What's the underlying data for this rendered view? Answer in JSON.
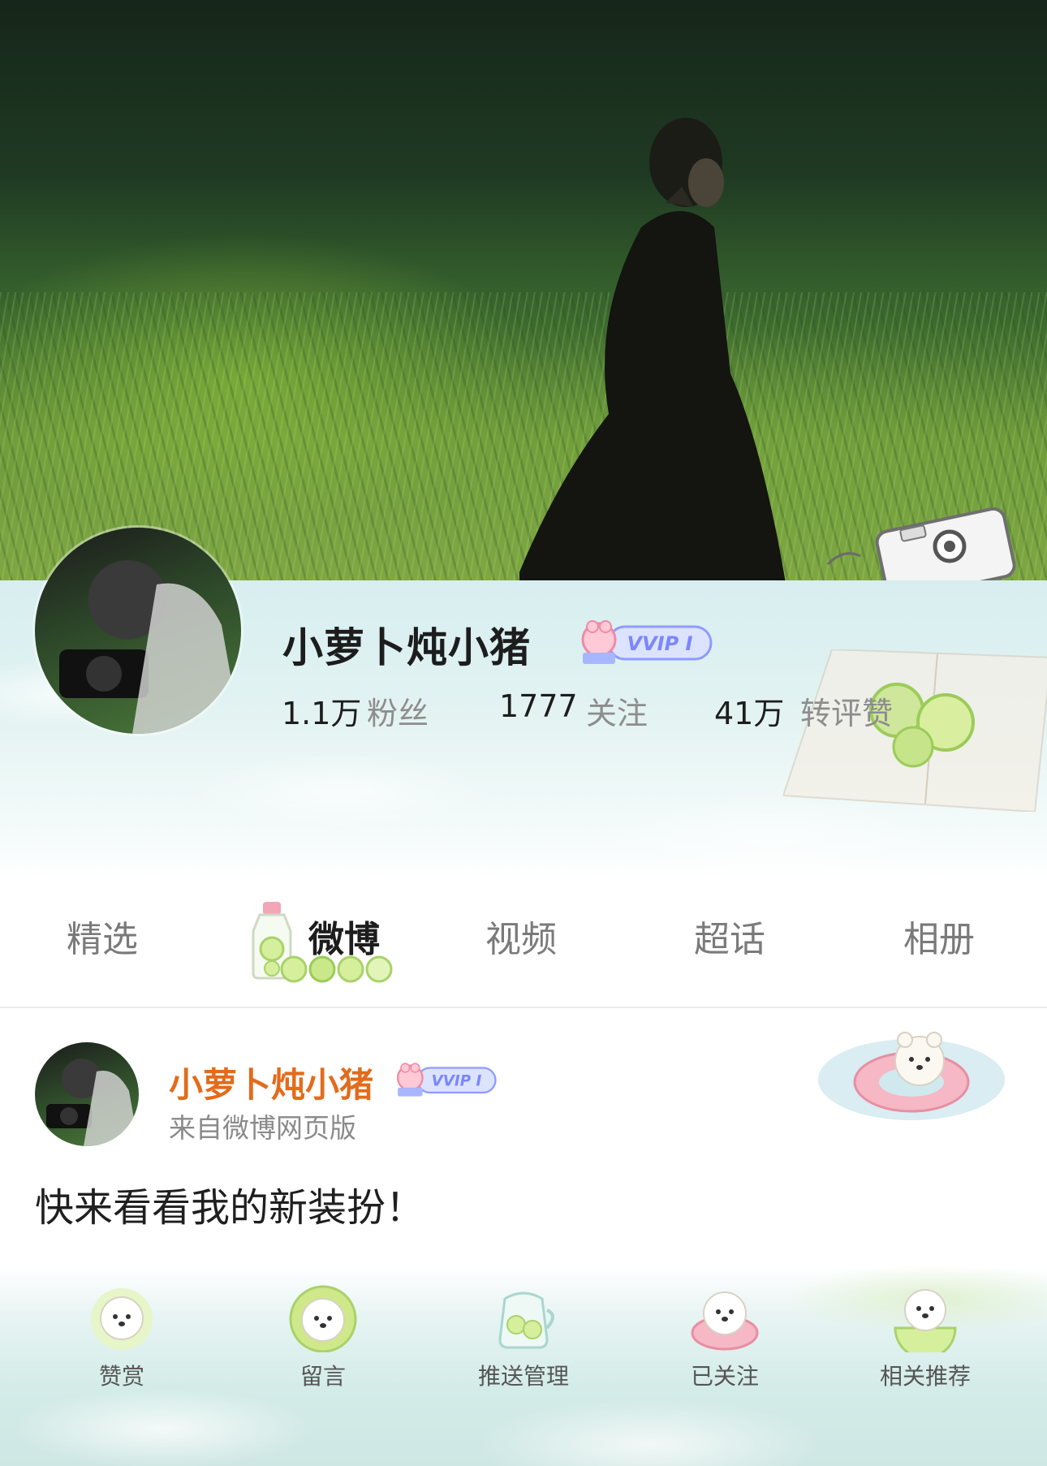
{
  "profile": {
    "username": "小萝卜炖小猪",
    "badge_text": "VVIP I",
    "stats": [
      {
        "value": "1.1万",
        "label": "粉丝"
      },
      {
        "value": "1777",
        "label": "关注"
      },
      {
        "value": "41万",
        "label": "转评赞"
      }
    ]
  },
  "tabs": [
    {
      "label": "精选",
      "active": false
    },
    {
      "label": "微博",
      "active": true
    },
    {
      "label": "视频",
      "active": false
    },
    {
      "label": "超话",
      "active": false
    },
    {
      "label": "相册",
      "active": false
    }
  ],
  "post": {
    "author": "小萝卜炖小猪",
    "badge_text": "VVIP I",
    "source": "来自微博网页版",
    "text": "快来看看我的新装扮！"
  },
  "actions": [
    {
      "label": "赞赏",
      "icon": "puppy-icon"
    },
    {
      "label": "留言",
      "icon": "puppy-lime-icon"
    },
    {
      "label": "推送管理",
      "icon": "lemon-jar-icon"
    },
    {
      "label": "已关注",
      "icon": "puppy-float-icon"
    },
    {
      "label": "相关推荐",
      "icon": "puppy-lime-slice-icon"
    }
  ],
  "colors": {
    "author_orange": "#e36b1b",
    "badge_blue": "#7b86ff",
    "panel_mint": "#d7eef0"
  }
}
